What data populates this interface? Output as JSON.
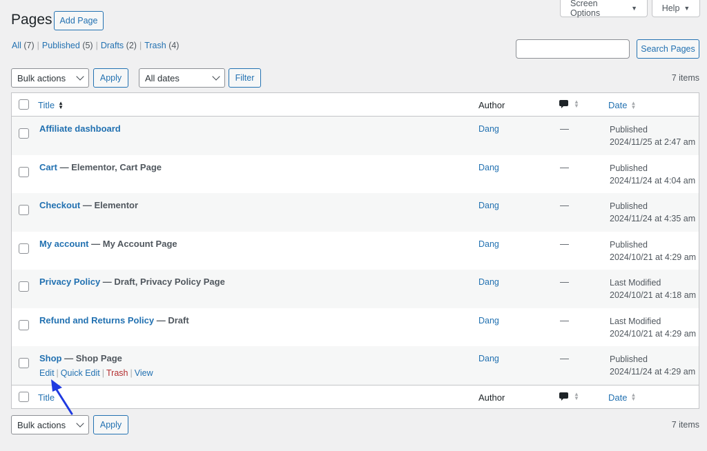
{
  "screen_meta": {
    "screen_options": "Screen Options",
    "help": "Help"
  },
  "header": {
    "title": "Pages",
    "add_new": "Add Page"
  },
  "filters": {
    "links": [
      {
        "label": "All",
        "count": "(7)"
      },
      {
        "label": "Published",
        "count": "(5)"
      },
      {
        "label": "Drafts",
        "count": "(2)"
      },
      {
        "label": "Trash",
        "count": "(4)"
      }
    ],
    "separator": "|"
  },
  "search": {
    "placeholder": "",
    "button": "Search Pages"
  },
  "tablenav_top": {
    "bulk_actions": "Bulk actions",
    "apply": "Apply",
    "dates": "All dates",
    "filter": "Filter",
    "items": "7 items"
  },
  "tablenav_bottom": {
    "bulk_actions": "Bulk actions",
    "apply": "Apply",
    "items": "7 items"
  },
  "columns": {
    "title": "Title",
    "author": "Author",
    "date": "Date",
    "comments_icon": "comment-bubble-icon"
  },
  "rows": [
    {
      "title": "Affiliate dashboard",
      "state": "",
      "author": "Dang",
      "comments": "—",
      "status": "Published",
      "date": "2024/11/25 at 2:47 am"
    },
    {
      "title": "Cart",
      "state": " — Elementor, Cart Page",
      "author": "Dang",
      "comments": "—",
      "status": "Published",
      "date": "2024/11/24 at 4:04 am"
    },
    {
      "title": "Checkout",
      "state": " — Elementor",
      "author": "Dang",
      "comments": "—",
      "status": "Published",
      "date": "2024/11/24 at 4:35 am"
    },
    {
      "title": "My account",
      "state": " — My Account Page",
      "author": "Dang",
      "comments": "—",
      "status": "Published",
      "date": "2024/10/21 at 4:29 am"
    },
    {
      "title": "Privacy Policy",
      "state": " — Draft, Privacy Policy Page",
      "author": "Dang",
      "comments": "—",
      "status": "Last Modified",
      "date": "2024/10/21 at 4:18 am"
    },
    {
      "title": "Refund and Returns Policy",
      "state": " — Draft",
      "author": "Dang",
      "comments": "—",
      "status": "Last Modified",
      "date": "2024/10/21 at 4:29 am"
    },
    {
      "title": "Shop",
      "state": " — Shop Page",
      "author": "Dang",
      "comments": "—",
      "status": "Published",
      "date": "2024/11/24 at 4:29 am"
    }
  ],
  "row_actions": {
    "edit": "Edit",
    "quick_edit": "Quick Edit",
    "trash": "Trash",
    "view": "View",
    "separator": "|"
  },
  "colors": {
    "link": "#2271b1",
    "trash": "#b32d2e",
    "annotation_arrow": "#1f3ae0"
  }
}
